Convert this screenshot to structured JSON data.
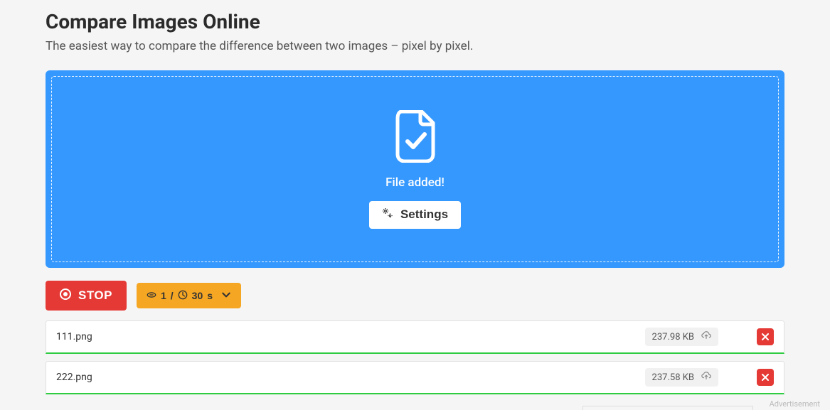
{
  "header": {
    "title": "Compare Images Online",
    "subtitle": "The easiest way to compare the difference between two images – pixel by pixel."
  },
  "dropzone": {
    "status_text": "File added!",
    "settings_label": "Settings"
  },
  "controls": {
    "stop_label": "STOP",
    "count": "1",
    "separator": "/",
    "duration_value": "30",
    "duration_unit": "s"
  },
  "files": [
    {
      "name": "111.png",
      "size": "237.98 KB"
    },
    {
      "name": "222.png",
      "size": "237.58 KB"
    }
  ],
  "ad": {
    "label": "Advertisement"
  }
}
